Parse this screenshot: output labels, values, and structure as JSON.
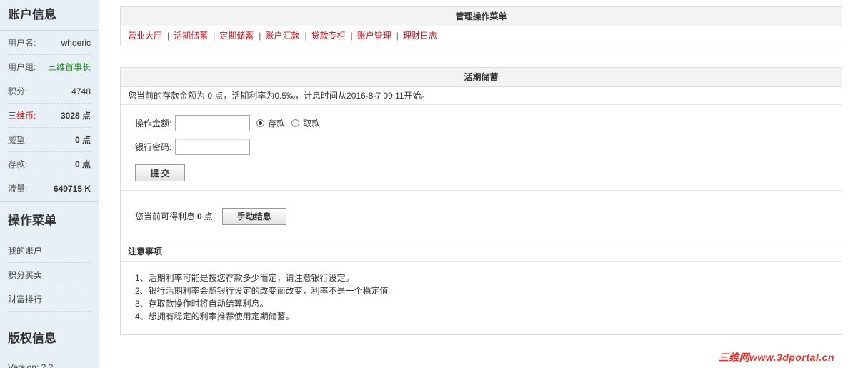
{
  "sidebar": {
    "account_title": "账户信息",
    "rows": [
      {
        "key": "用户名:",
        "value": "whoeric"
      },
      {
        "key": "用户组:",
        "value": "三维首事长"
      },
      {
        "key": "积分:",
        "value": "4748"
      },
      {
        "key": "三维币:",
        "value": "3028 点"
      },
      {
        "key": "威望:",
        "value": "0 点"
      },
      {
        "key": "存款:",
        "value": "0 点"
      },
      {
        "key": "流量:",
        "value": "649715 K"
      }
    ],
    "menu_title": "操作菜单",
    "menu_items": [
      "我的账户",
      "积分买卖",
      "财富排行"
    ],
    "copyright_title": "版权信息",
    "version": "Version: 2.2"
  },
  "top_menu": {
    "title": "管理操作菜单",
    "items": [
      "营业大厅",
      "活期储蓄",
      "定期储蓄",
      "账户汇款",
      "贷款专柜",
      "账户管理",
      "理财日志"
    ]
  },
  "savings": {
    "title": "活期储蓄",
    "info": "您当前的存款金额为 0 点，活期利率为0.5‰，计息时间从2016-8-7 09:11开始。",
    "amount_label": "操作金额:",
    "radio_deposit": "存款",
    "radio_withdraw": "取款",
    "password_label": "银行密码:",
    "submit_label": "提 交",
    "interest_prefix": "您当前可得利息",
    "interest_value": "0",
    "interest_unit": "点",
    "settle_label": "手动结息",
    "notice_title": "注意事项",
    "notices": [
      "1、活期利率可能是按您存款多少而定，请注意银行设定。",
      "2、银行活期利率会随银行设定的改变而改变，利率不是一个稳定值。",
      "3、存取款操作时将自动结算利息。",
      "4、想拥有稳定的利率推荐使用定期储蓄。"
    ]
  },
  "watermark": "三维网www.3dportal.cn"
}
